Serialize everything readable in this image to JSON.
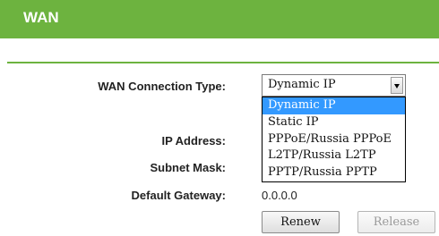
{
  "header": {
    "title": "WAN"
  },
  "form": {
    "connection_type_label": "WAN Connection Type:",
    "connection_type_value": "Dynamic IP",
    "connection_type_options": [
      "Dynamic IP",
      "Static IP",
      "PPPoE/Russia PPPoE",
      "L2TP/Russia L2TP",
      "PPTP/Russia PPTP"
    ],
    "ip_address_label": "IP Address:",
    "subnet_mask_label": "Subnet Mask:",
    "default_gateway_label": "Default Gateway:",
    "default_gateway_value": "0.0.0.0"
  },
  "buttons": {
    "renew": "Renew",
    "release": "Release"
  },
  "colors": {
    "accent": "#6db33f",
    "selection": "#3399ff"
  }
}
